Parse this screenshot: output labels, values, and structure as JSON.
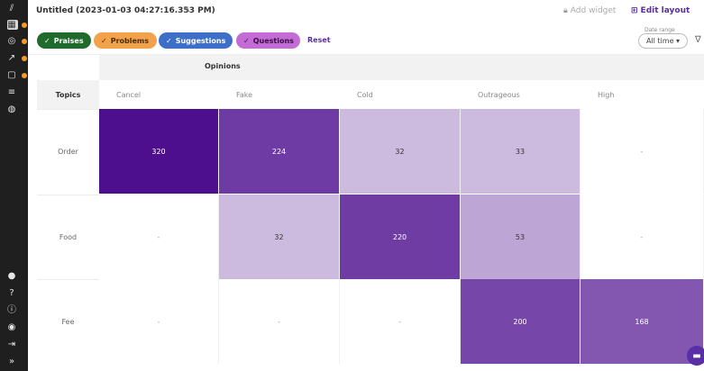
{
  "sidebar": {
    "items": [
      {
        "icon": "logo-icon",
        "glyph": "⫽"
      },
      {
        "icon": "dashboard-icon",
        "glyph": "▦"
      },
      {
        "icon": "target-icon",
        "glyph": "◎"
      },
      {
        "icon": "trend-icon",
        "glyph": "↗"
      },
      {
        "icon": "document-icon",
        "glyph": "▢"
      },
      {
        "icon": "list-icon",
        "glyph": "≡"
      },
      {
        "icon": "circle-icon",
        "glyph": "◍"
      },
      {
        "icon": "bulb-icon",
        "glyph": "●"
      },
      {
        "icon": "help-icon",
        "glyph": "?"
      },
      {
        "icon": "info-icon",
        "glyph": "ⓘ"
      },
      {
        "icon": "user-icon",
        "glyph": "◉"
      },
      {
        "icon": "logout-icon",
        "glyph": "⇥"
      },
      {
        "icon": "expand-icon",
        "glyph": "»"
      }
    ]
  },
  "header": {
    "title": "Untitled (2023-01-03 04:27:16.353 PM)",
    "add_widget": "Add widget",
    "edit_layout": "Edit layout",
    "more": "•••"
  },
  "filters": {
    "chips": [
      {
        "label": "Praises",
        "color": "#1f6b2c"
      },
      {
        "label": "Problems",
        "color": "#f2a24a"
      },
      {
        "label": "Suggestions",
        "color": "#3d6fc9"
      },
      {
        "label": "Questions",
        "color": "#c46cd6"
      }
    ],
    "reset": "Reset",
    "date_range_label": "Date range",
    "date_range_value": "All time ▾"
  },
  "table": {
    "opinions_label": "Opinions",
    "topics_label": "Topics",
    "columns": [
      "Cancel",
      "Fake",
      "Cold",
      "Outrageous",
      "High"
    ],
    "rows": [
      {
        "label": "Order",
        "values": [
          "320",
          "224",
          "32",
          "33",
          "-"
        ]
      },
      {
        "label": "Food",
        "values": [
          "-",
          "32",
          "220",
          "53",
          "-"
        ]
      },
      {
        "label": "Fee",
        "values": [
          "-",
          "-",
          "-",
          "200",
          "168"
        ]
      }
    ],
    "scale_max": 320,
    "color_high": "#4e0f8f",
    "color_low": "#ffffff"
  }
}
